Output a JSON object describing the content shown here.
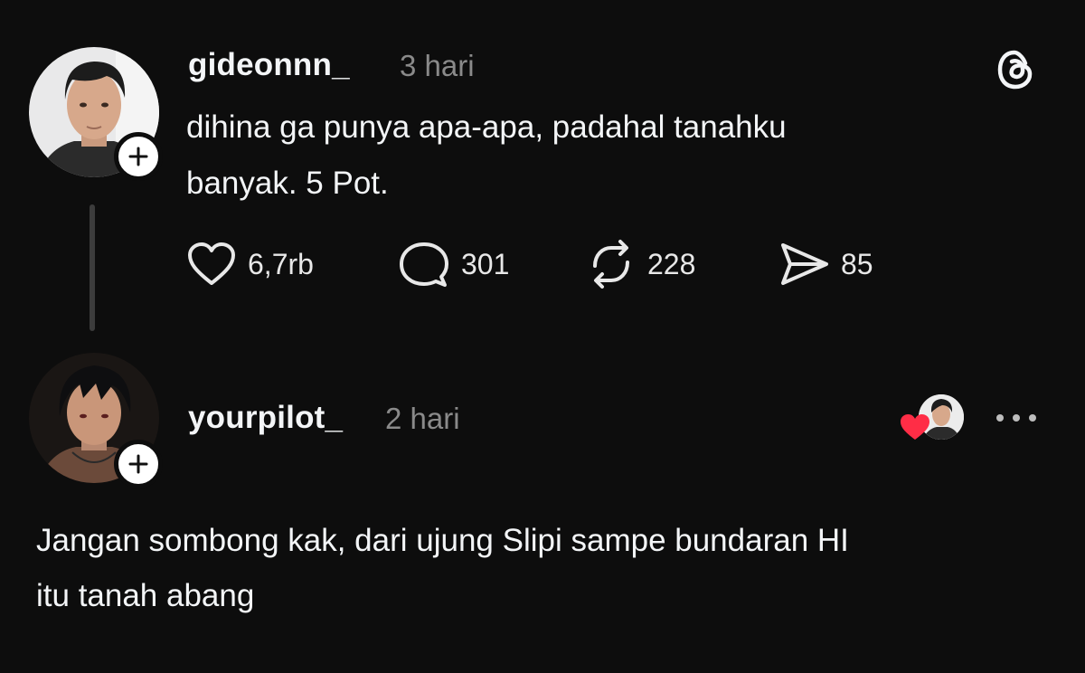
{
  "post": {
    "username": "gideonnn_",
    "time": "3 hari",
    "text_line1": "dihina ga punya apa-apa, padahal tanahku",
    "text_line2": "banyak. 5 Pot.",
    "actions": {
      "likes": "6,7rb",
      "replies": "301",
      "reposts": "228",
      "shares": "85"
    }
  },
  "reply": {
    "username": "yourpilot_",
    "time": "2 hari",
    "text_line1": "Jangan sombong kak, dari ujung Slipi sampe bundaran HI",
    "text_line2": "itu tanah abang"
  },
  "icons": {
    "app_logo": "threads-logo-icon",
    "like": "heart-icon",
    "reply": "comment-icon",
    "repost": "repost-icon",
    "share": "send-icon",
    "more": "more-options-icon",
    "liked_by": "red-heart-icon"
  },
  "colors": {
    "background": "#0d0d0d",
    "text": "#f3f5f7",
    "muted": "#8a8a8a",
    "heart": "#ff2d46"
  }
}
